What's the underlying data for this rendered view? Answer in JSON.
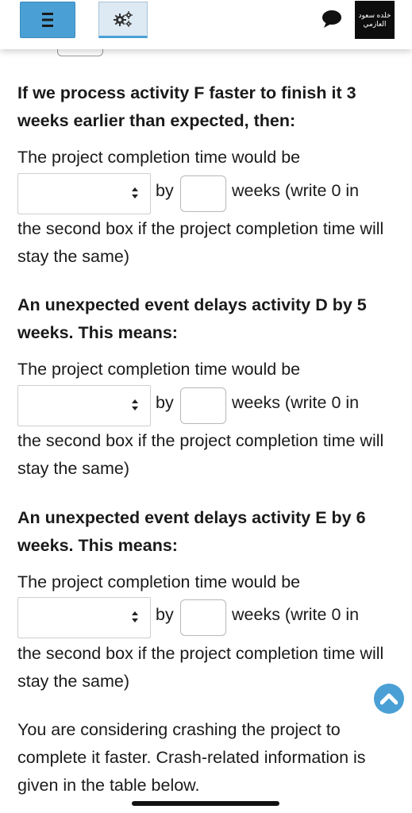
{
  "header": {
    "menu_icon": "hamburger-icon",
    "settings_icon": "gears-icon",
    "chat_icon": "speech-bubble-icon",
    "user_name_line1": "خلده سعود",
    "user_name_line2": "العازمي",
    "accent_color": "#4aa0d5"
  },
  "questions": [
    {
      "heading": "If we process activity F faster to finish it 3 weeks earlier than expected, then:",
      "lead": "The project completion time would be",
      "select_value": "",
      "by_label": "by",
      "weeks_value": "",
      "weeks_suffix": "weeks (write 0 in",
      "tail": "the second box if the project completion time will stay the same)"
    },
    {
      "heading": "An unexpected event delays activity D by 5 weeks. This means:",
      "lead": "The project completion time would be",
      "select_value": "",
      "by_label": "by",
      "weeks_value": "",
      "weeks_suffix": "weeks (write 0 in",
      "tail": "the second box if the project completion time will stay the same)"
    },
    {
      "heading": "An unexpected event delays activity E by 6 weeks. This means:",
      "lead": "The project completion time would be",
      "select_value": "",
      "by_label": "by",
      "weeks_value": "",
      "weeks_suffix": "weeks (write 0 in",
      "tail": "the second box if the project completion time will stay the same)"
    }
  ],
  "final_paragraph": "You are considering crashing the project to complete it faster. Crash-related information is given in the table below.",
  "scroll_top_icon": "chevron-up-icon"
}
